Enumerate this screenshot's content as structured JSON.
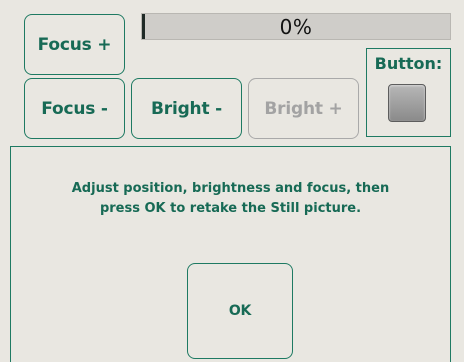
{
  "buttons": {
    "focus_plus": "Focus +",
    "focus_minus": "Focus -",
    "bright_minus": "Bright -",
    "bright_plus": "Bright +",
    "ok": "OK"
  },
  "progress": {
    "value_percent": 0,
    "label": "0%"
  },
  "button_indicator": {
    "label": "Button:",
    "state": "off"
  },
  "message": {
    "line1": "Adjust position, brightness and focus, then",
    "line2": "press OK to retake the Still picture."
  },
  "colors": {
    "accent": "#1e7a62",
    "background": "#e9e7e1",
    "disabled": "#a9a9a9"
  }
}
